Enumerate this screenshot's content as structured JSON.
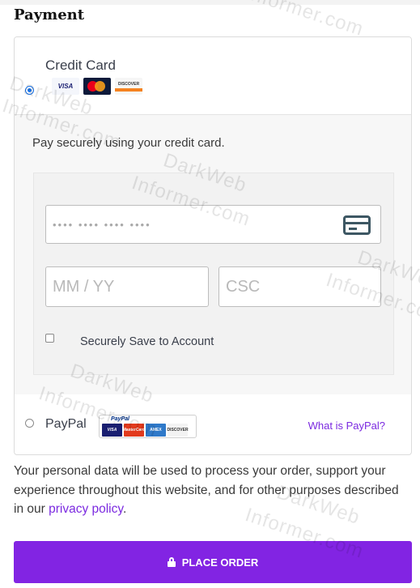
{
  "heading": "Payment",
  "credit_card": {
    "title": "Credit Card",
    "logos": [
      "visa-logo",
      "mastercard-logo",
      "discover-logo"
    ],
    "logo_text": {
      "visa": "VISA",
      "discover": "DISCOVER"
    },
    "description": "Pay securely using your credit card.",
    "card_number_placeholder": "•••• •••• •••• ••••",
    "expiry_placeholder": "MM / YY",
    "csc_placeholder": "CSC",
    "save_label": "Securely Save to Account",
    "selected": true
  },
  "paypal": {
    "title": "PayPal",
    "logo_text": {
      "paypal": "PayPal",
      "visa": "VISA",
      "mastercard": "MasterCard",
      "amex": "AMEX",
      "discover": "DISCOVER"
    },
    "link": "What is PayPal?",
    "selected": false
  },
  "notice": {
    "text": "Your personal data will be used to process your order, support your experience throughout this website, and for other purposes described in our ",
    "link": "privacy policy",
    "suffix": "."
  },
  "place_order": "PLACE ORDER",
  "watermark": {
    "line1": "DarkWeb",
    "line2": "Informer.com"
  },
  "colors": {
    "accent": "#8224e3",
    "link": "#7b2ae0",
    "radio_selected": "#1a73e8"
  }
}
